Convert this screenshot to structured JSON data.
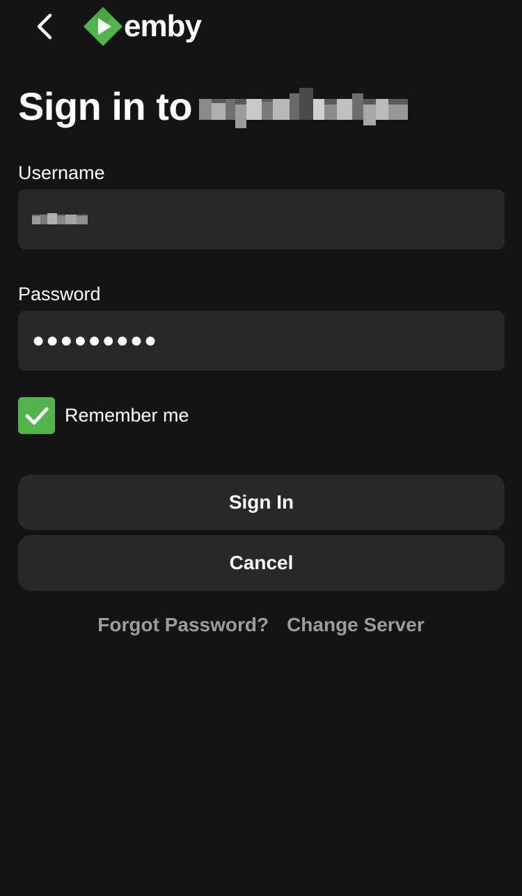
{
  "app": {
    "name": "emby",
    "brand_color": "#52b54b"
  },
  "header": {
    "back_icon": "chevron-left-icon",
    "logo_icon": "emby-logo-icon",
    "logo_text": "emby"
  },
  "page": {
    "title": "Sign in to"
  },
  "form": {
    "username_label": "Username",
    "password_label": "Password",
    "password_mask": "●●●●●●●●●",
    "remember_label": "Remember me",
    "remember_checked": true
  },
  "actions": {
    "sign_in_label": "Sign In",
    "cancel_label": "Cancel",
    "forgot_password_label": "Forgot Password?",
    "change_server_label": "Change Server"
  }
}
